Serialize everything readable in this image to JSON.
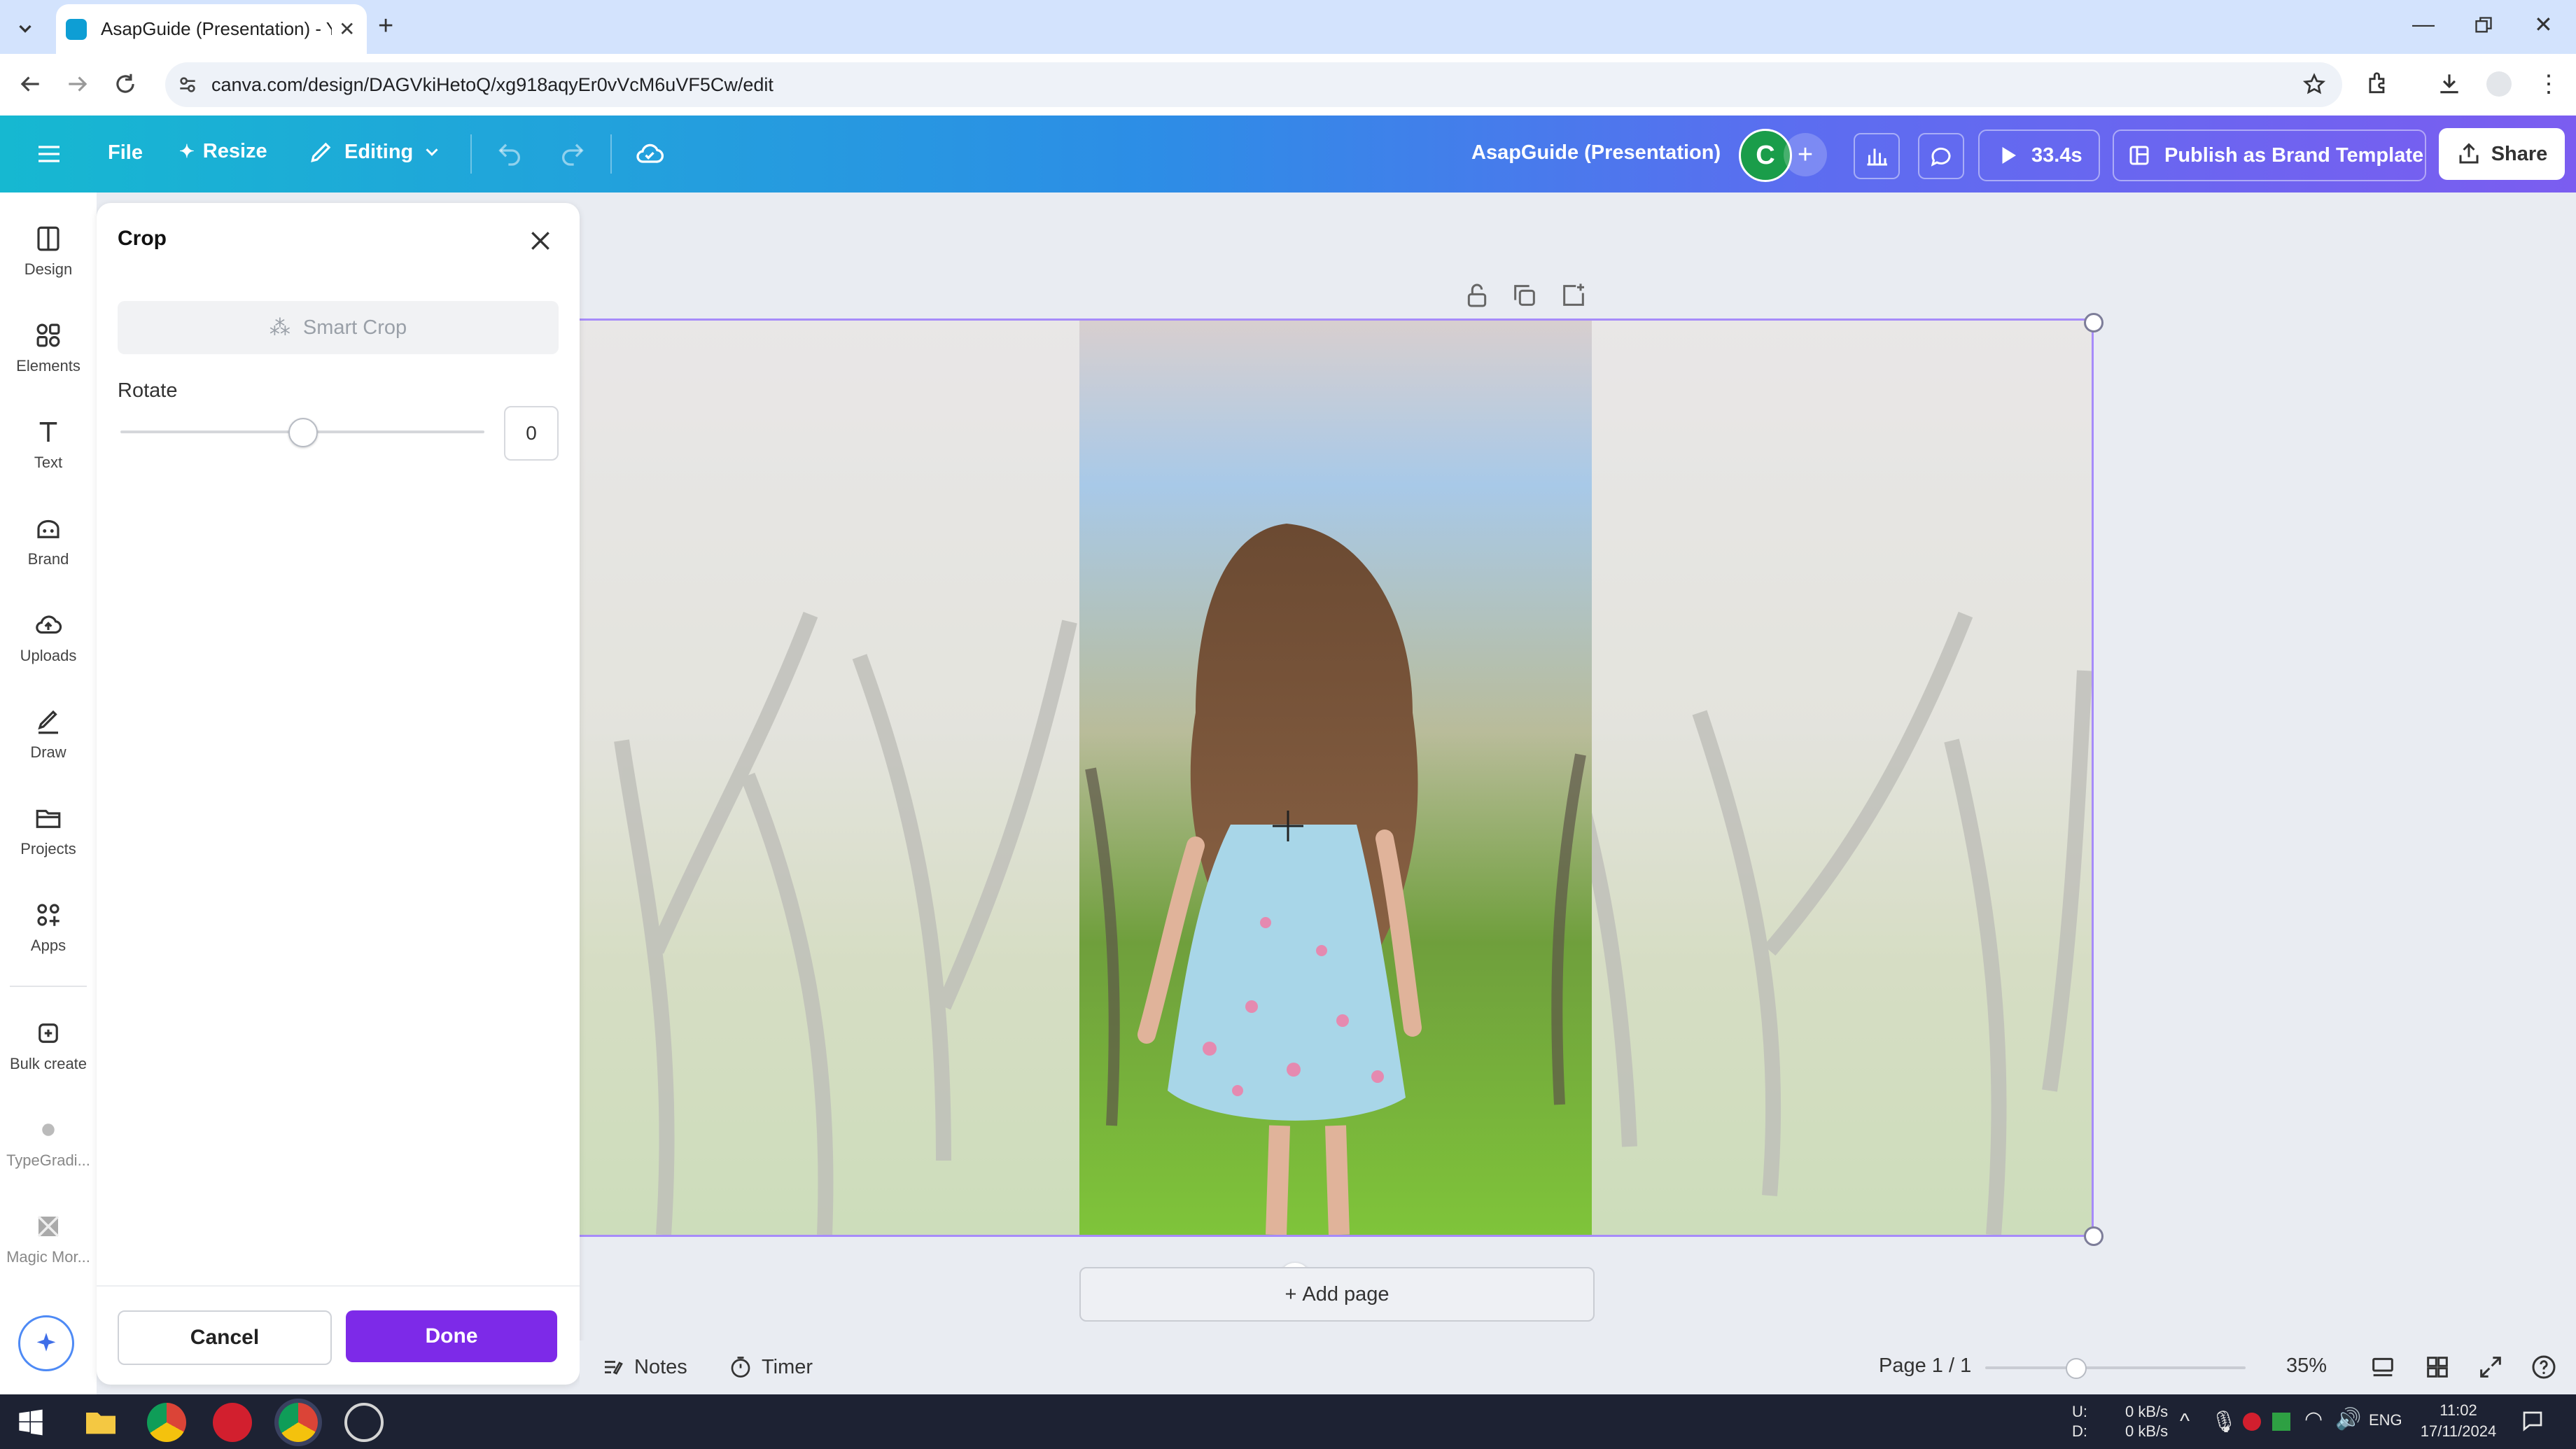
{
  "browser": {
    "tab_title": "AsapGuide (Presentation) - You",
    "url": "canva.com/design/DAGVkiHetoQ/xg918aqyEr0vVcM6uVF5Cw/edit"
  },
  "header": {
    "file": "File",
    "resize": "Resize",
    "editing": "Editing",
    "doc_title": "AsapGuide (Presentation)",
    "avatar_letter": "C",
    "present_time": "33.4s",
    "publish": "Publish as Brand Template",
    "share": "Share"
  },
  "rail": {
    "items": [
      {
        "label": "Design"
      },
      {
        "label": "Elements"
      },
      {
        "label": "Text"
      },
      {
        "label": "Brand"
      },
      {
        "label": "Uploads"
      },
      {
        "label": "Draw"
      },
      {
        "label": "Projects"
      },
      {
        "label": "Apps"
      },
      {
        "label": "Bulk create"
      },
      {
        "label": "TypeGradi..."
      },
      {
        "label": "Magic Mor..."
      }
    ]
  },
  "crop_panel": {
    "title": "Crop",
    "smart_crop": "Smart Crop",
    "rotate_label": "Rotate",
    "rotate_value": "0",
    "rotate_level": 0.5,
    "cancel": "Cancel",
    "done": "Done"
  },
  "canvas": {
    "add_page": "Add page"
  },
  "bottom": {
    "notes": "Notes",
    "timer": "Timer",
    "page": "Page 1 / 1",
    "zoom": "35%",
    "zoom_level": 0.35
  },
  "taskbar": {
    "net_up_label": "U:",
    "net_down_label": "D:",
    "net_up": "0 kB/s",
    "net_down": "0 kB/s",
    "lang": "ENG",
    "time": "11:02",
    "date": "17/11/2024"
  }
}
